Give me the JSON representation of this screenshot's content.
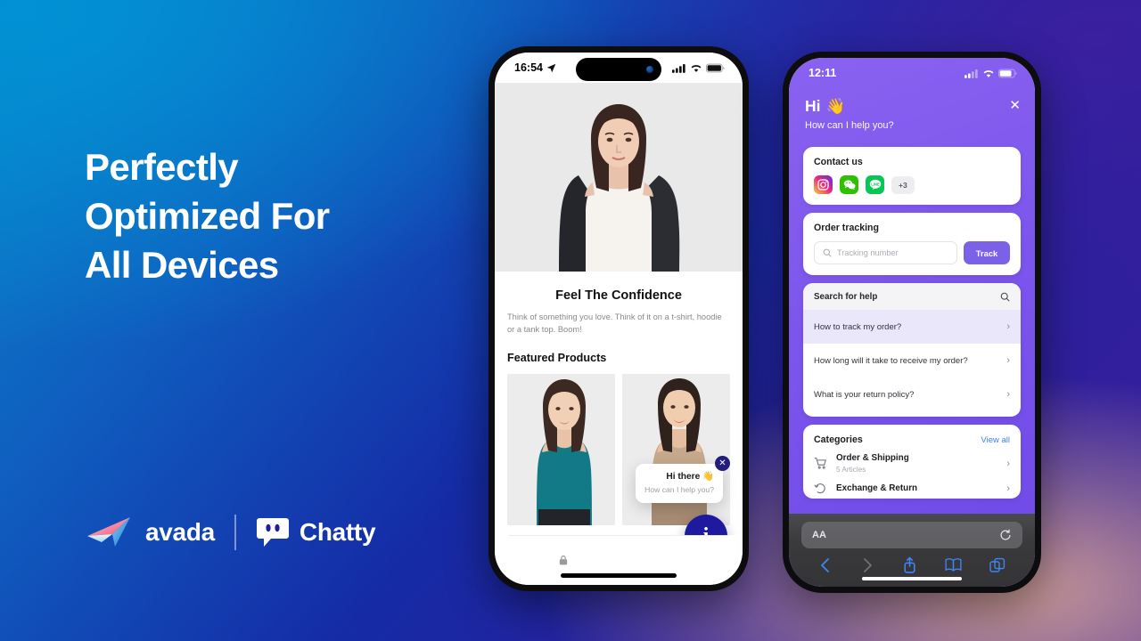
{
  "headline": {
    "line1": "Perfectly",
    "line2": "Optimized For",
    "line3": "All Devices"
  },
  "brand": {
    "avada_name": "avada",
    "avada_icon": "paper-plane-icon",
    "chatty_name": "Chatty",
    "chatty_icon": "chat-bubble-icon"
  },
  "phone_left": {
    "status": {
      "time": "16:54",
      "location_icon": "location-arrow-icon",
      "signal_icon": "cellular-signal-icon",
      "wifi_icon": "wifi-icon",
      "battery_icon": "battery-icon"
    },
    "store": {
      "title": "Feel The Confidence",
      "description": "Think of something you love. Think of it on a t-shirt, hoodie or a tank top. Boom!",
      "featured_heading": "Featured Products",
      "lock_icon": "lock-icon"
    },
    "bubble": {
      "greeting": "Hi there",
      "greeting_emoji": "👋",
      "question": "How can I help you?",
      "close_icon": "close-icon",
      "fab_icon": "info-icon",
      "fab_label": "i"
    }
  },
  "phone_right": {
    "status": {
      "time": "12:11",
      "signal_icon": "cellular-signal-icon",
      "wifi_icon": "wifi-icon",
      "battery_icon": "battery-icon"
    },
    "header": {
      "greeting": "Hi",
      "greeting_emoji": "👋",
      "subtitle": "How can I help you?",
      "close_icon": "close-icon"
    },
    "contact": {
      "title": "Contact us",
      "channels": [
        {
          "name": "instagram-icon",
          "color": "#e1306c"
        },
        {
          "name": "wechat-icon",
          "color": "#2dc100"
        },
        {
          "name": "line-icon",
          "color": "#06c755"
        }
      ],
      "more_label": "+3"
    },
    "order_tracking": {
      "title": "Order tracking",
      "placeholder": "Tracking number",
      "search_icon": "search-icon",
      "button_label": "Track",
      "button_color": "#7b61e8"
    },
    "help": {
      "search_label": "Search for help",
      "search_icon": "search-icon",
      "items": [
        {
          "label": "How to track my order?",
          "active": true
        },
        {
          "label": "How long will it take to receive my order?",
          "active": false
        },
        {
          "label": "What is your return policy?",
          "active": false
        }
      ],
      "chevron_icon": "chevron-right-icon"
    },
    "categories": {
      "title": "Categories",
      "view_all": "View all",
      "view_all_color": "#3b82f6",
      "items": [
        {
          "name": "Order & Shipping",
          "count": "5 Articles",
          "icon": "shopping-cart-icon"
        },
        {
          "name": "Exchange & Return",
          "count": "",
          "icon": "return-arrow-icon"
        }
      ]
    },
    "safari": {
      "text_size_label": "AA",
      "reload_icon": "reload-icon",
      "back_icon": "chevron-left-icon",
      "forward_icon": "chevron-right-icon",
      "share_icon": "share-icon",
      "bookmarks_icon": "book-icon",
      "tabs_icon": "tabs-icon"
    }
  }
}
